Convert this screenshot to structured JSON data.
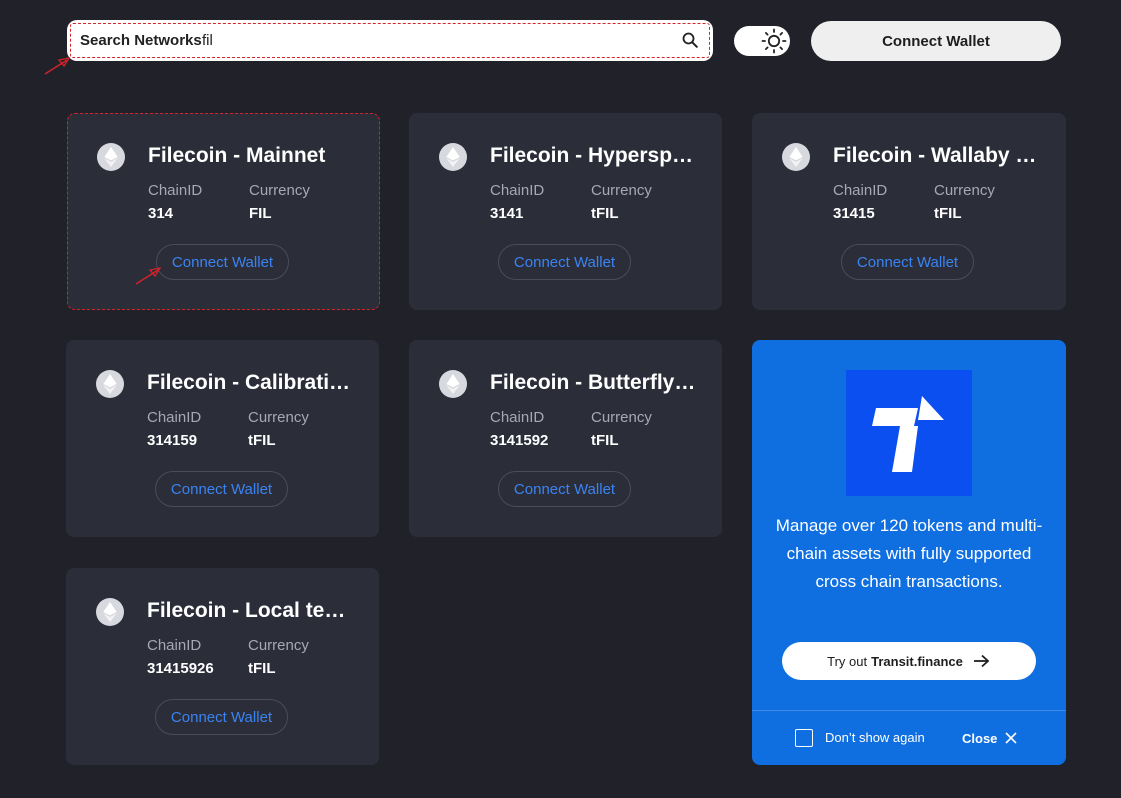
{
  "header": {
    "search": {
      "label": "Search Networks",
      "value": "fil"
    },
    "connect_wallet_label": "Connect Wallet"
  },
  "labels": {
    "chain_id": "ChainID",
    "currency": "Currency"
  },
  "networks": [
    {
      "name": "Filecoin - Mainnet",
      "chain_id": "314",
      "currency": "FIL",
      "connect_label": "Connect Wallet"
    },
    {
      "name": "Filecoin - Hyperspace testnet",
      "chain_id": "3141",
      "currency": "tFIL",
      "connect_label": "Connect Wallet"
    },
    {
      "name": "Filecoin - Wallaby testnet",
      "chain_id": "31415",
      "currency": "tFIL",
      "connect_label": "Connect Wallet"
    },
    {
      "name": "Filecoin - Calibration testnet",
      "chain_id": "314159",
      "currency": "tFIL",
      "connect_label": "Connect Wallet"
    },
    {
      "name": "Filecoin - Butterfly testnet",
      "chain_id": "3141592",
      "currency": "tFIL",
      "connect_label": "Connect Wallet"
    },
    {
      "name": "Filecoin - Local testnet",
      "chain_id": "31415926",
      "currency": "tFIL",
      "connect_label": "Connect Wallet"
    }
  ],
  "promo": {
    "text": "Manage over 120 tokens and multi-chain assets with fully supported cross chain transactions.",
    "cta_prefix": "Try out",
    "cta_brand": "Transit.finance",
    "dont_show_label": "Don’t show again",
    "close_label": "Close"
  },
  "colors": {
    "background": "#202129",
    "card": "#2b2d39",
    "link_blue": "#3a84f2",
    "promo_blue": "#0f6fe0",
    "annotation_red": "#d2232a"
  }
}
